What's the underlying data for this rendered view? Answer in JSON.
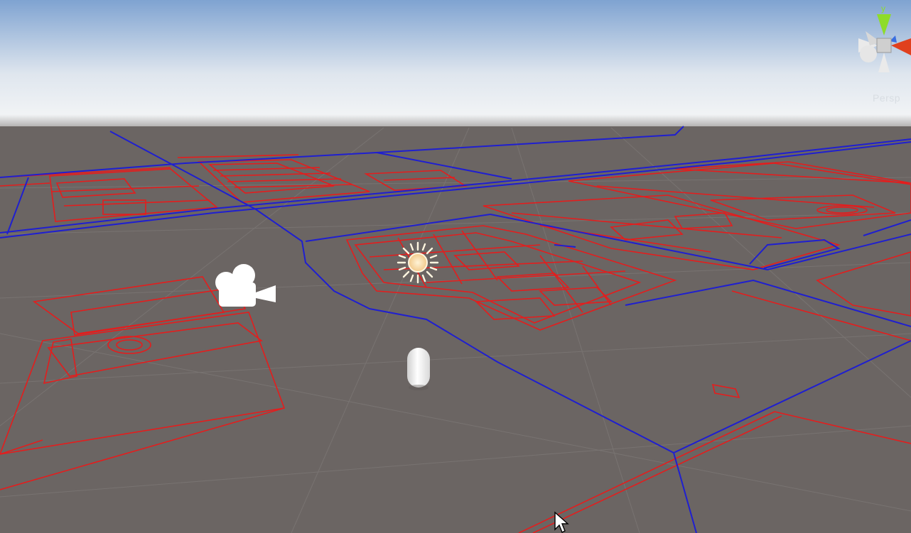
{
  "view": {
    "projection_label": "Persp"
  },
  "gizmo": {
    "axes": [
      "y-axis",
      "x-axis",
      "z-axis"
    ],
    "colors": {
      "y": "#8edc2a",
      "x": "#e0401e",
      "z": "#3a6ee0",
      "neutral": "#e8e8e8"
    }
  },
  "scene_objects": [
    {
      "name": "camera",
      "icon": "camera-icon"
    },
    {
      "name": "directional-light",
      "icon": "sun-icon"
    },
    {
      "name": "capsule",
      "icon": "capsule-icon"
    }
  ],
  "colors": {
    "sky_top": "#7fa3d1",
    "sky_horizon": "#eef2f6",
    "ground": "#6b6563",
    "grid": "#7c7775",
    "building_lines": "#e41d1d",
    "road_lines": "#1f1fd0"
  }
}
